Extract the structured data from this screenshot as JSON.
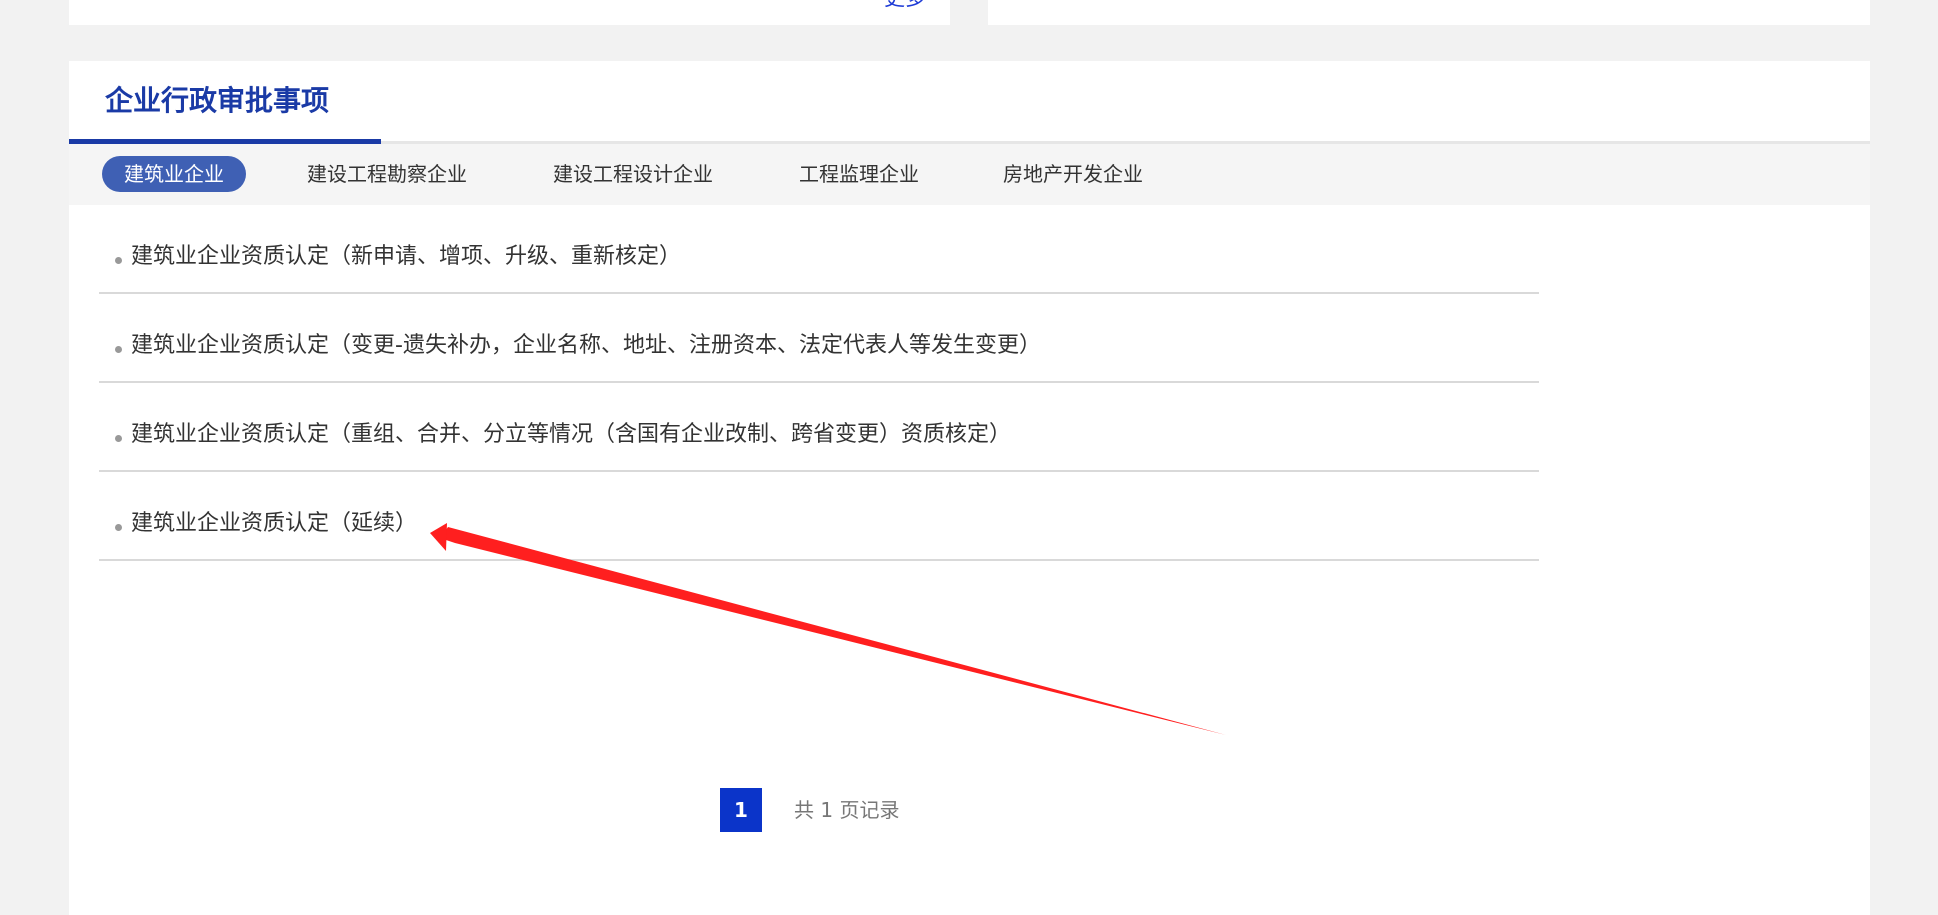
{
  "top_left_card": {
    "more_label": "更多"
  },
  "section": {
    "title": "企业行政审批事项",
    "colors": {
      "title": "#1a3aa6",
      "active_tab_bg": "#3f60b4",
      "pager_current_bg": "#0b34c9",
      "annotation_arrow": "#ff1f1f"
    }
  },
  "tabs": [
    {
      "label": "建筑业企业",
      "active": true
    },
    {
      "label": "建设工程勘察企业",
      "active": false
    },
    {
      "label": "建设工程设计企业",
      "active": false
    },
    {
      "label": "工程监理企业",
      "active": false
    },
    {
      "label": "房地产开发企业",
      "active": false
    }
  ],
  "items": [
    {
      "text": "建筑业企业资质认定（新申请、增项、升级、重新核定）"
    },
    {
      "text": "建筑业企业资质认定（变更-遗失补办，企业名称、地址、注册资本、法定代表人等发生变更）"
    },
    {
      "text": "建筑业企业资质认定（重组、合并、分立等情况（含国有企业改制、跨省变更）资质核定）"
    },
    {
      "text": "建筑业企业资质认定（延续）"
    }
  ],
  "pagination": {
    "current_page": "1",
    "summary": "共 1 页记录"
  }
}
